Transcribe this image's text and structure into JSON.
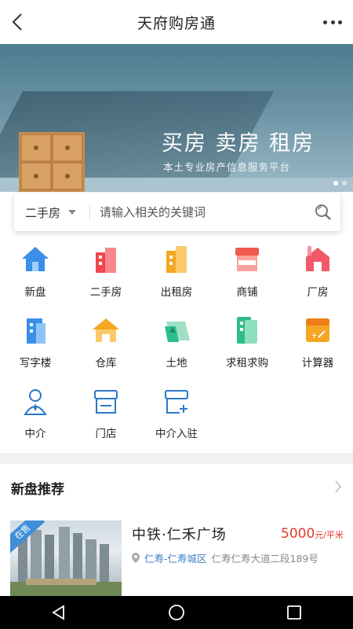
{
  "header": {
    "title": "天府购房通",
    "back_icon": "chevron-left-icon",
    "more_icon": "more-dots-icon"
  },
  "banner": {
    "headline": "买房  卖房  租房",
    "subtitle": "本土专业房产信息服务平台",
    "slide_count": 2,
    "active_slide": 1
  },
  "search": {
    "type_selected": "二手房",
    "placeholder": "请输入相关的关键词",
    "icon": "search-icon"
  },
  "categories": [
    {
      "label": "新盘",
      "icon": "house-icon",
      "color": "#3b8fe8"
    },
    {
      "label": "二手房",
      "icon": "building-icon",
      "color": "#f0474b"
    },
    {
      "label": "出租房",
      "icon": "apartment-icon",
      "color": "#f5a623"
    },
    {
      "label": "商铺",
      "icon": "shop-icon",
      "color": "#f05a4f"
    },
    {
      "label": "厂房",
      "icon": "factory-icon",
      "color": "#f05a68"
    },
    {
      "label": "写字楼",
      "icon": "office-building-icon",
      "color": "#3b8fe8"
    },
    {
      "label": "仓库",
      "icon": "warehouse-icon",
      "color": "#f5a623"
    },
    {
      "label": "土地",
      "icon": "land-icon",
      "color": "#2dbd8a"
    },
    {
      "label": "求租求购",
      "icon": "wanted-icon",
      "color": "#2dbd8a"
    },
    {
      "label": "计算器",
      "icon": "calculator-icon",
      "color": "#f5a623"
    },
    {
      "label": "中介",
      "icon": "agent-icon",
      "color": "#2b78c8"
    },
    {
      "label": "门店",
      "icon": "store-icon",
      "color": "#2b78c8"
    },
    {
      "label": "中介入驻",
      "icon": "agent-join-icon",
      "color": "#2b78c8"
    }
  ],
  "new_homes": {
    "title": "新盘推荐",
    "arrow_icon": "chevron-right-icon",
    "items": [
      {
        "status_tag": "在售",
        "name": "中铁·仁禾广场",
        "price": "5000",
        "price_unit": "元/平米",
        "area": "仁寿-仁寿城区",
        "address": "仁寿仁寿大道二段189号"
      }
    ]
  },
  "system_nav": {
    "back_icon": "triangle-back-icon",
    "home_icon": "circle-home-icon",
    "recents_icon": "square-recents-icon"
  }
}
